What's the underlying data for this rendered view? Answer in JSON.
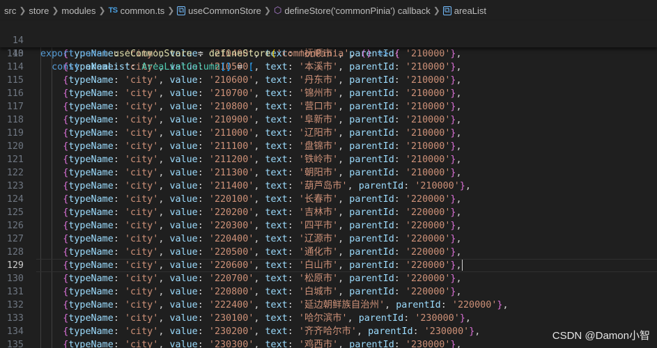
{
  "breadcrumb": {
    "items": [
      "src",
      "store",
      "modules",
      "common.ts",
      "useCommonStore",
      "defineStore('commonPinia') callback",
      "areaList"
    ],
    "ts_badge": "TS"
  },
  "sticky_lines": [
    {
      "num": "14",
      "text": "export const useCommonStore = defineStore('commonPinia', () => {"
    },
    {
      "num": "40",
      "text": "  const areaList: AreaListColumn[] = ["
    }
  ],
  "current_line": "129",
  "rows": [
    {
      "num": "113",
      "value": "210400",
      "text": "抚顺市",
      "parentId": "210000"
    },
    {
      "num": "114",
      "value": "210500",
      "text": "本溪市",
      "parentId": "210000"
    },
    {
      "num": "115",
      "value": "210600",
      "text": "丹东市",
      "parentId": "210000"
    },
    {
      "num": "116",
      "value": "210700",
      "text": "锦州市",
      "parentId": "210000"
    },
    {
      "num": "117",
      "value": "210800",
      "text": "营口市",
      "parentId": "210000"
    },
    {
      "num": "118",
      "value": "210900",
      "text": "阜新市",
      "parentId": "210000"
    },
    {
      "num": "119",
      "value": "211000",
      "text": "辽阳市",
      "parentId": "210000"
    },
    {
      "num": "120",
      "value": "211100",
      "text": "盘锦市",
      "parentId": "210000"
    },
    {
      "num": "121",
      "value": "211200",
      "text": "铁岭市",
      "parentId": "210000"
    },
    {
      "num": "122",
      "value": "211300",
      "text": "朝阳市",
      "parentId": "210000"
    },
    {
      "num": "123",
      "value": "211400",
      "text": "葫芦岛市",
      "parentId": "210000"
    },
    {
      "num": "124",
      "value": "220100",
      "text": "长春市",
      "parentId": "220000"
    },
    {
      "num": "125",
      "value": "220200",
      "text": "吉林市",
      "parentId": "220000"
    },
    {
      "num": "126",
      "value": "220300",
      "text": "四平市",
      "parentId": "220000"
    },
    {
      "num": "127",
      "value": "220400",
      "text": "辽源市",
      "parentId": "220000"
    },
    {
      "num": "128",
      "value": "220500",
      "text": "通化市",
      "parentId": "220000"
    },
    {
      "num": "129",
      "value": "220600",
      "text": "白山市",
      "parentId": "220000"
    },
    {
      "num": "130",
      "value": "220700",
      "text": "松原市",
      "parentId": "220000"
    },
    {
      "num": "131",
      "value": "220800",
      "text": "白城市",
      "parentId": "220000"
    },
    {
      "num": "132",
      "value": "222400",
      "text": "延边朝鲜族自治州",
      "parentId": "220000"
    },
    {
      "num": "133",
      "value": "230100",
      "text": "哈尔滨市",
      "parentId": "230000"
    },
    {
      "num": "134",
      "value": "230200",
      "text": "齐齐哈尔市",
      "parentId": "230000"
    },
    {
      "num": "135",
      "value": "230300",
      "text": "鸡西市",
      "parentId": "230000"
    }
  ],
  "row_type_name": "city",
  "watermark": "CSDN @Damon小智"
}
